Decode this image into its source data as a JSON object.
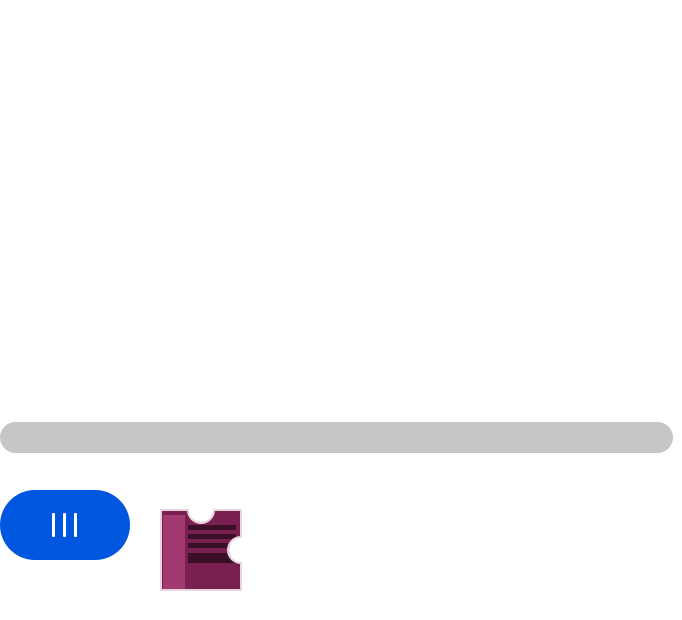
{
  "captcha": {
    "slider": {
      "track_color": "#c6c6c6",
      "handle_color": "#0056df",
      "handle_icon": "three-vertical-bars-grip-icon",
      "grip_color": "#ffffff",
      "progress": 0
    },
    "puzzle_piece": {
      "icon": "jigsaw-puzzle-piece-icon",
      "colors": {
        "base": "#7a2050",
        "dark": "#3a0f28",
        "highlight": "#a23a72",
        "border": "#e8d6de"
      }
    }
  }
}
